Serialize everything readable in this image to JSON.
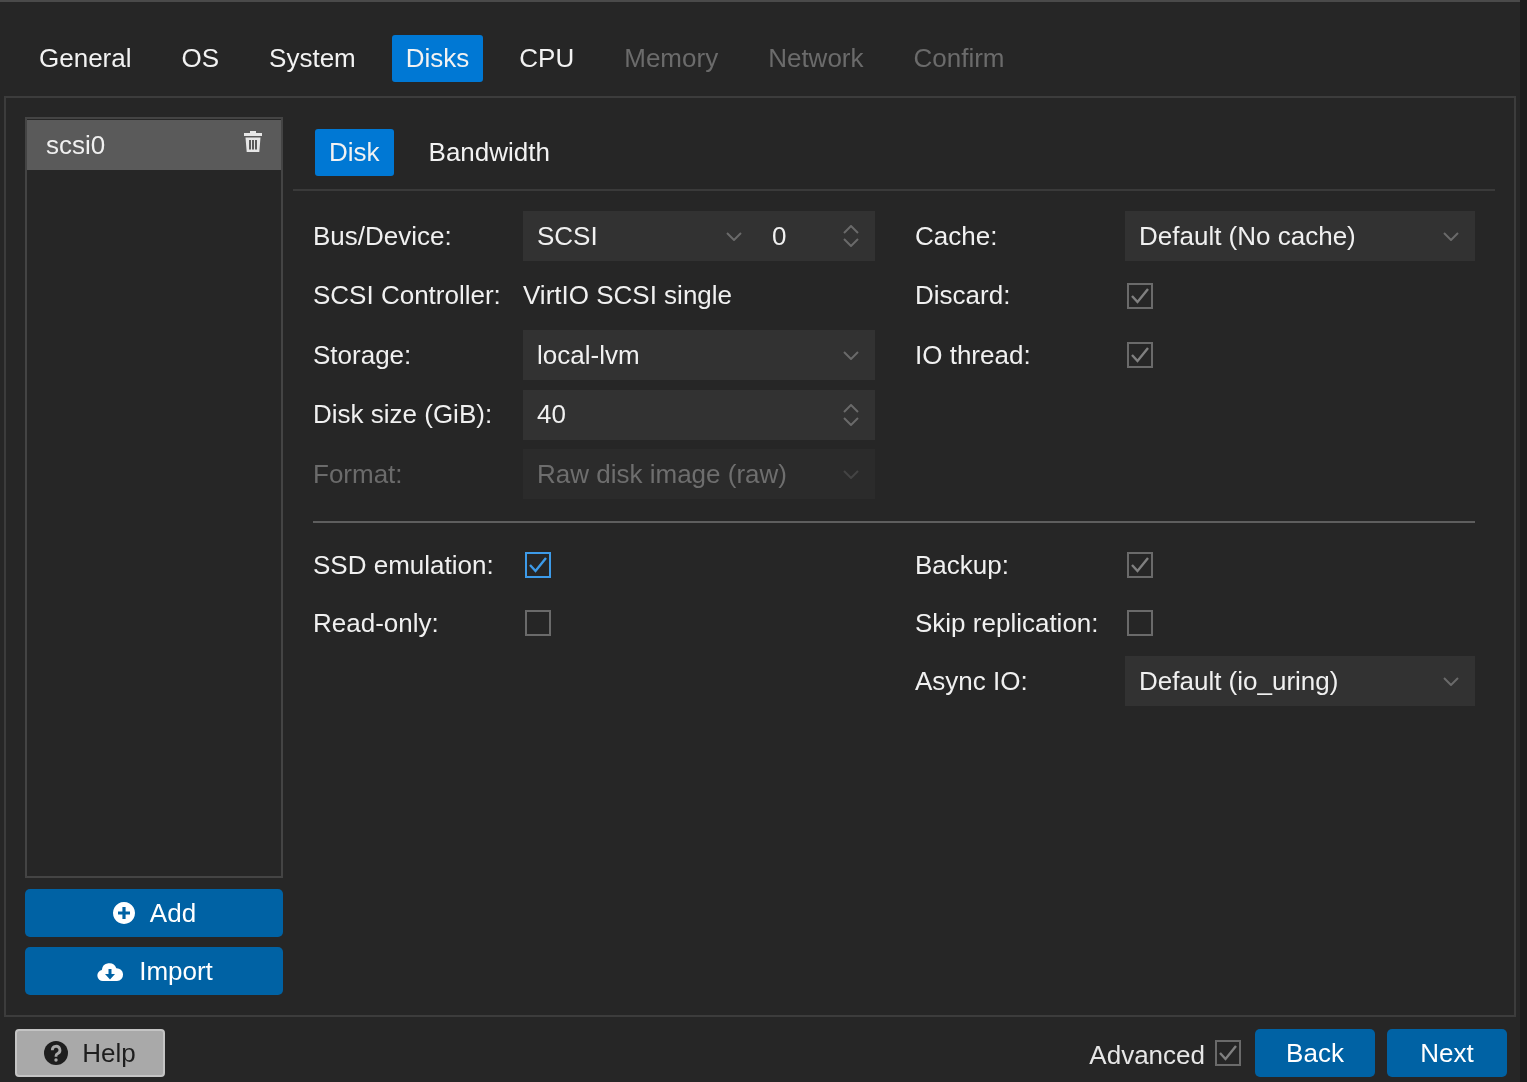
{
  "wizard_tabs": [
    {
      "label": "General",
      "selected": false,
      "disabled": false
    },
    {
      "label": "OS",
      "selected": false,
      "disabled": false
    },
    {
      "label": "System",
      "selected": false,
      "disabled": false
    },
    {
      "label": "Disks",
      "selected": true,
      "disabled": false
    },
    {
      "label": "CPU",
      "selected": false,
      "disabled": false
    },
    {
      "label": "Memory",
      "selected": false,
      "disabled": true
    },
    {
      "label": "Network",
      "selected": false,
      "disabled": true
    },
    {
      "label": "Confirm",
      "selected": false,
      "disabled": true
    }
  ],
  "disk_list": {
    "items": [
      {
        "label": "scsi0",
        "selected": true
      }
    ]
  },
  "disk_list_buttons": [
    {
      "kind": "add",
      "label": "Add"
    },
    {
      "kind": "import",
      "label": "Import"
    }
  ],
  "sub_tabs": [
    {
      "label": "Disk",
      "selected": true
    },
    {
      "label": "Bandwidth",
      "selected": false
    }
  ],
  "disk_form": {
    "left": [
      {
        "label": "Bus/Device:",
        "kind": "select_number",
        "value": "SCSI",
        "number": "0",
        "disabled": false
      },
      {
        "label": "SCSI Controller:",
        "kind": "text",
        "value": "VirtIO SCSI single",
        "disabled": false
      },
      {
        "label": "Storage:",
        "kind": "select",
        "value": "local-lvm",
        "disabled": false
      },
      {
        "label": "Disk size (GiB):",
        "kind": "number",
        "value": "40",
        "disabled": false
      },
      {
        "label": "Format:",
        "kind": "select",
        "value": "Raw disk image (raw)",
        "disabled": true
      }
    ],
    "right": [
      {
        "label": "Cache:",
        "kind": "select",
        "value": "Default (No cache)",
        "disabled": false
      },
      {
        "label": "Discard:",
        "kind": "checkbox",
        "checked": true,
        "disabled": false,
        "focused": false
      },
      {
        "label": "IO thread:",
        "kind": "checkbox",
        "checked": true,
        "disabled": false,
        "focused": false
      }
    ]
  },
  "advanced_options": {
    "left": [
      {
        "label": "SSD emulation:",
        "kind": "checkbox",
        "checked": true,
        "disabled": false,
        "focused": true
      },
      {
        "label": "Read-only:",
        "kind": "checkbox",
        "checked": false,
        "disabled": false,
        "focused": false
      }
    ],
    "right": [
      {
        "label": "Backup:",
        "kind": "checkbox",
        "checked": true,
        "disabled": false,
        "focused": false
      },
      {
        "label": "Skip replication:",
        "kind": "checkbox",
        "checked": false,
        "disabled": false,
        "focused": false
      },
      {
        "label": "Async IO:",
        "kind": "select",
        "value": "Default (io_uring)",
        "disabled": false
      }
    ]
  },
  "footer": {
    "help_button": "Help",
    "advanced": {
      "label": "Advanced",
      "checked": true
    },
    "buttons": [
      "Back",
      "Next"
    ]
  }
}
